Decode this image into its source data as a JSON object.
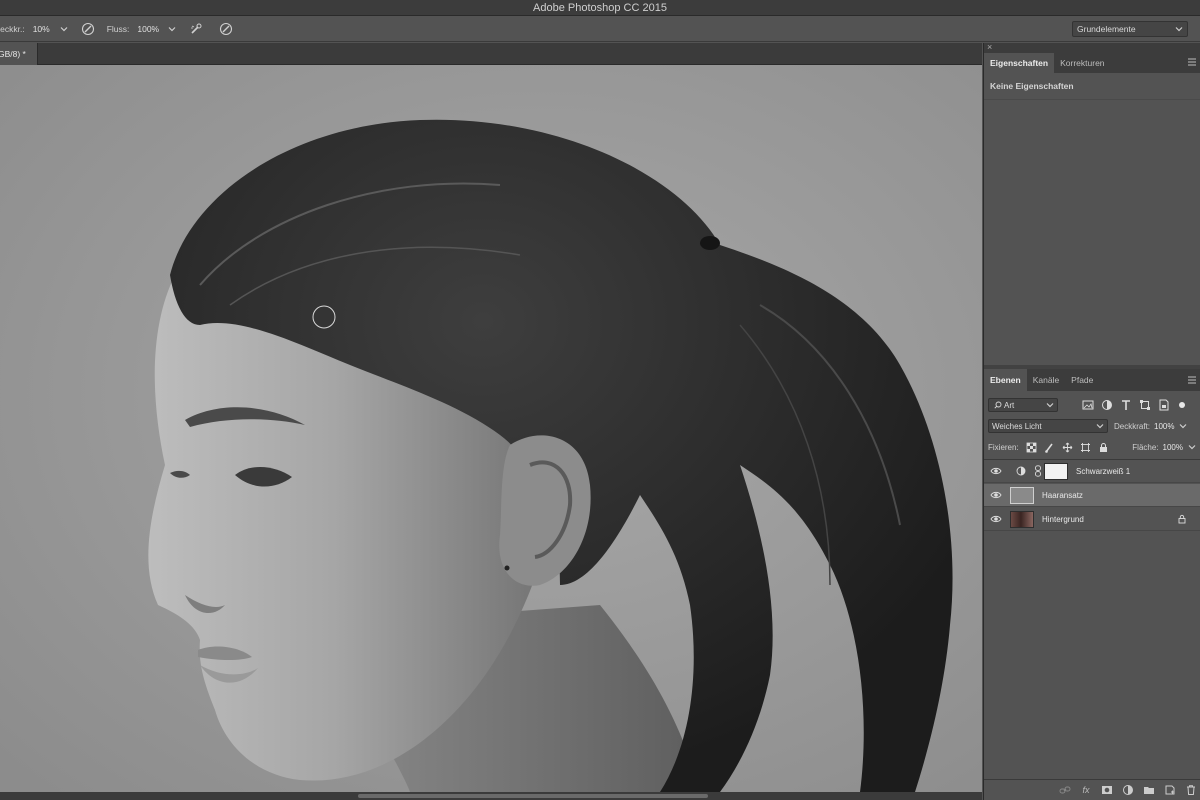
{
  "app": {
    "title": "Adobe Photoshop CC 2015"
  },
  "options_bar": {
    "opacity_label": "Deckkr.:",
    "opacity_value": "10%",
    "flow_label": "Fluss:",
    "flow_value": "100%",
    "workspace": "Grundelemente"
  },
  "document": {
    "tab_label": "GB/8) *"
  },
  "properties_panel": {
    "tabs": [
      {
        "label": "Eigenschaften",
        "active": true
      },
      {
        "label": "Korrekturen",
        "active": false
      }
    ],
    "message": "Keine Eigenschaften"
  },
  "layers_panel": {
    "tabs": [
      {
        "label": "Ebenen",
        "active": true
      },
      {
        "label": "Kanäle",
        "active": false
      },
      {
        "label": "Pfade",
        "active": false
      }
    ],
    "filter_kind": "Art",
    "blend_mode": "Weiches Licht",
    "opacity_label": "Deckkraft:",
    "opacity_value": "100%",
    "lock_label": "Fixieren:",
    "fill_label": "Fläche:",
    "fill_value": "100%",
    "layers": [
      {
        "name": "Schwarzweiß 1",
        "type": "adjustment",
        "selected": false,
        "locked": false
      },
      {
        "name": "Haaransatz",
        "type": "pixel",
        "selected": true,
        "locked": false
      },
      {
        "name": "Hintergrund",
        "type": "background",
        "selected": false,
        "locked": true
      }
    ],
    "footer_fx": "fx"
  },
  "colors": {
    "panel_bg": "#535353",
    "panel_dark": "#3c3c3c",
    "selected_row": "#6a6a6a"
  }
}
